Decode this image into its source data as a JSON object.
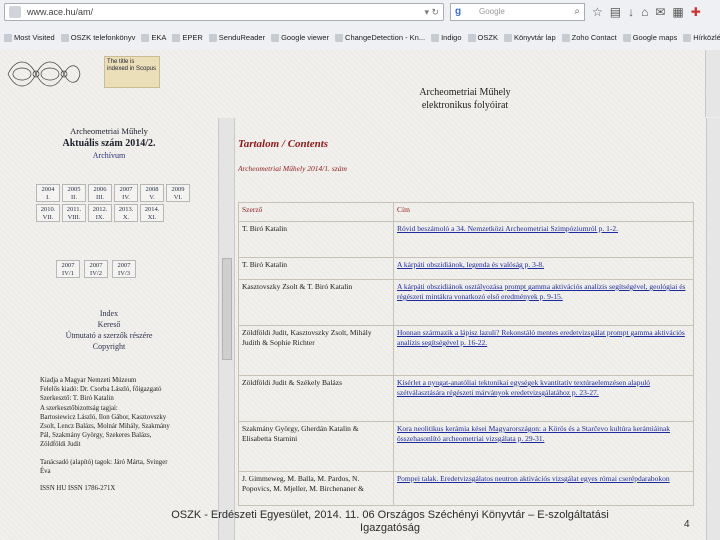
{
  "browser": {
    "url": "www.ace.hu/am/",
    "search_placeholder": "Google",
    "search_engine_icon": "google-icon",
    "bookmarks": [
      "Most Visited",
      "OSZK telefonkönyv",
      "EKA",
      "EPER",
      "SenduReader",
      "Google viewer",
      "ChangeDetection - Kn...",
      "Indigo",
      "OSZK",
      "Könyvtár lap",
      "Zoho Contact",
      "Google maps",
      "Hírközlés"
    ]
  },
  "header": {
    "index_badge": "The title is indexed in Scopus",
    "title_line1": "Archeometriai Műhely",
    "title_line2": "elektronikus folyóirat"
  },
  "left": {
    "journal_name": "Archeometriai Műhely",
    "current_issue": "Aktuális szám 2014/2.",
    "archive_label": "Archívum",
    "volumes": [
      {
        "year": "2004",
        "num": "I."
      },
      {
        "year": "2005",
        "num": "II."
      },
      {
        "year": "2006",
        "num": "III."
      },
      {
        "year": "2007",
        "num": "IV."
      },
      {
        "year": "2008",
        "num": "V."
      },
      {
        "year": "2009",
        "num": "VI."
      },
      {
        "year": "2010.",
        "num": "VII."
      },
      {
        "year": "2011.",
        "num": "VIII."
      },
      {
        "year": "2012.",
        "num": "IX."
      },
      {
        "year": "2013.",
        "num": "X."
      },
      {
        "year": "2014.",
        "num": "XI."
      },
      {
        "year": "",
        "num": ""
      }
    ],
    "volumes2": [
      {
        "year": "2007",
        "num": "IV/1"
      },
      {
        "year": "2007",
        "num": "IV/2"
      },
      {
        "year": "2007",
        "num": "IV/3"
      }
    ],
    "links": [
      "Index",
      "Kereső",
      "Útmutató a szerzők részére",
      "Copyright"
    ],
    "staff": [
      "Kiadja a Magyar Nemzeti Múzeum",
      "Felelős kiadó: Dr. Csorba László, főigazgató",
      "Szerkesztő: T. Biró Katalin",
      "A szerkesztőbizottság tagjai:",
      "Bartosiewicz László, Ilon Gábor, Kasztovszky",
      "Zsolt, Lencz Balázs, Molnár Mihály, Szakmány",
      "Pál, Szakmány György, Szekeres Balázs,",
      "Zöldföldi Judit",
      "",
      "Tanácsadó (alapító) tagok: Járó Márta, Svinger",
      "Éva",
      "",
      "ISSN HU ISSN 1786-271X"
    ]
  },
  "content": {
    "heading": "Tartalom / Contents",
    "issue_label": "Archeometriai Műhely 2014/1. szám",
    "col_author": "Szerző",
    "col_title": "Cím",
    "rows": [
      {
        "author": "T. Biró Katalin",
        "title": "Rövid beszámoló a 34. Nemzetközi Archeometriai Szimpóziumról p. 1-2."
      },
      {
        "author": "T. Biró Katalin",
        "title": "A kárpáti obszidiánok, legenda és valóság p. 3-8."
      },
      {
        "author": "Kasztovszky Zsolt & T. Biró Katalin",
        "title": "A kárpáti obszidiánok osztályozása prompt gamma aktivációs analízis segítségével, geológiai és régészeti mintákra vonatkozó első eredmények p. 9-15."
      },
      {
        "author": "Zöldföldi Judit, Kasztovszky Zsolt, Mihály Judith & Sophie Richter",
        "title": "Honnan származik a lápisz lazuli? Rekonstáló mentes eredetvizsgálat prompt gamma aktivációs analízis segítségével p. 16-22."
      },
      {
        "author": "Zöldföldi Judit & Székely Balázs",
        "title": "Kísérlet a nyugat-anatóliai tektonikai egységek kvantitatív textúraelemzésen alapuló szétválasztására régészeti márványok eredetvizsgálatához p. 23-27."
      },
      {
        "author": "Szakmány György, Gherdán Katalin & Elisabetta Starnini",
        "title": "Kora neolitikus kerámia kései Magyarországon: a Körös és a Starčevo kultúra kerámiáinak összehasonlító archeometriai vizsgálata p. 29-31."
      },
      {
        "author": "J. Gimmeweg, M. Balla, M. Pardos, N. Popovics, M. Mjeller, M. Birchenaner &",
        "title": "Pompei talak. Eredetvizsgálatos neutron aktivációs vizsgálat egyes római cserépdarabokon"
      }
    ]
  },
  "footer": {
    "text_line1": "OSZK - Erdészeti Egyesület, 2014. 11. 06 Országos Széchényi Könyvtár – E-szolgáltatási",
    "text_line2": "Igazgatóság",
    "page_number": "4"
  }
}
